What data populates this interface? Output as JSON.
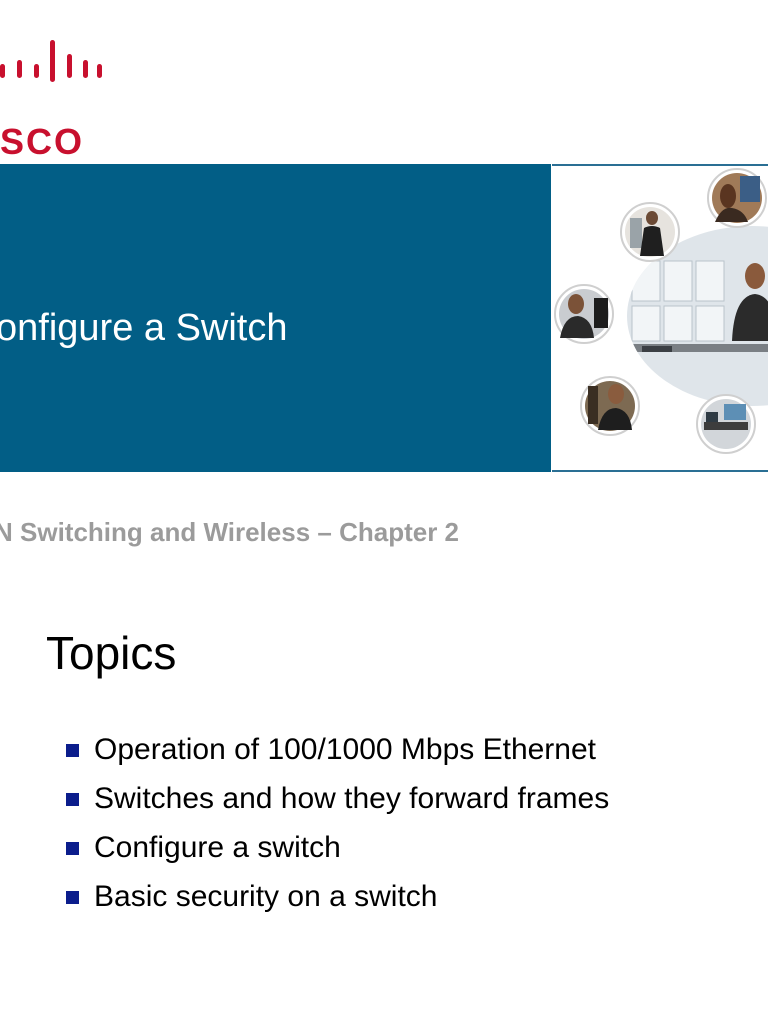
{
  "logo": {
    "text": "SCO",
    "brand_color": "#c8102e"
  },
  "banner": {
    "title": "onfigure a Switch",
    "background_color": "#025e86"
  },
  "subtitle": "N Switching and Wireless – Chapter 2",
  "topics": {
    "heading": "Topics",
    "items": [
      "Operation of 100/1000 Mbps Ethernet",
      "Switches and how they forward frames",
      "Configure a switch",
      "Basic security on a switch"
    ]
  }
}
